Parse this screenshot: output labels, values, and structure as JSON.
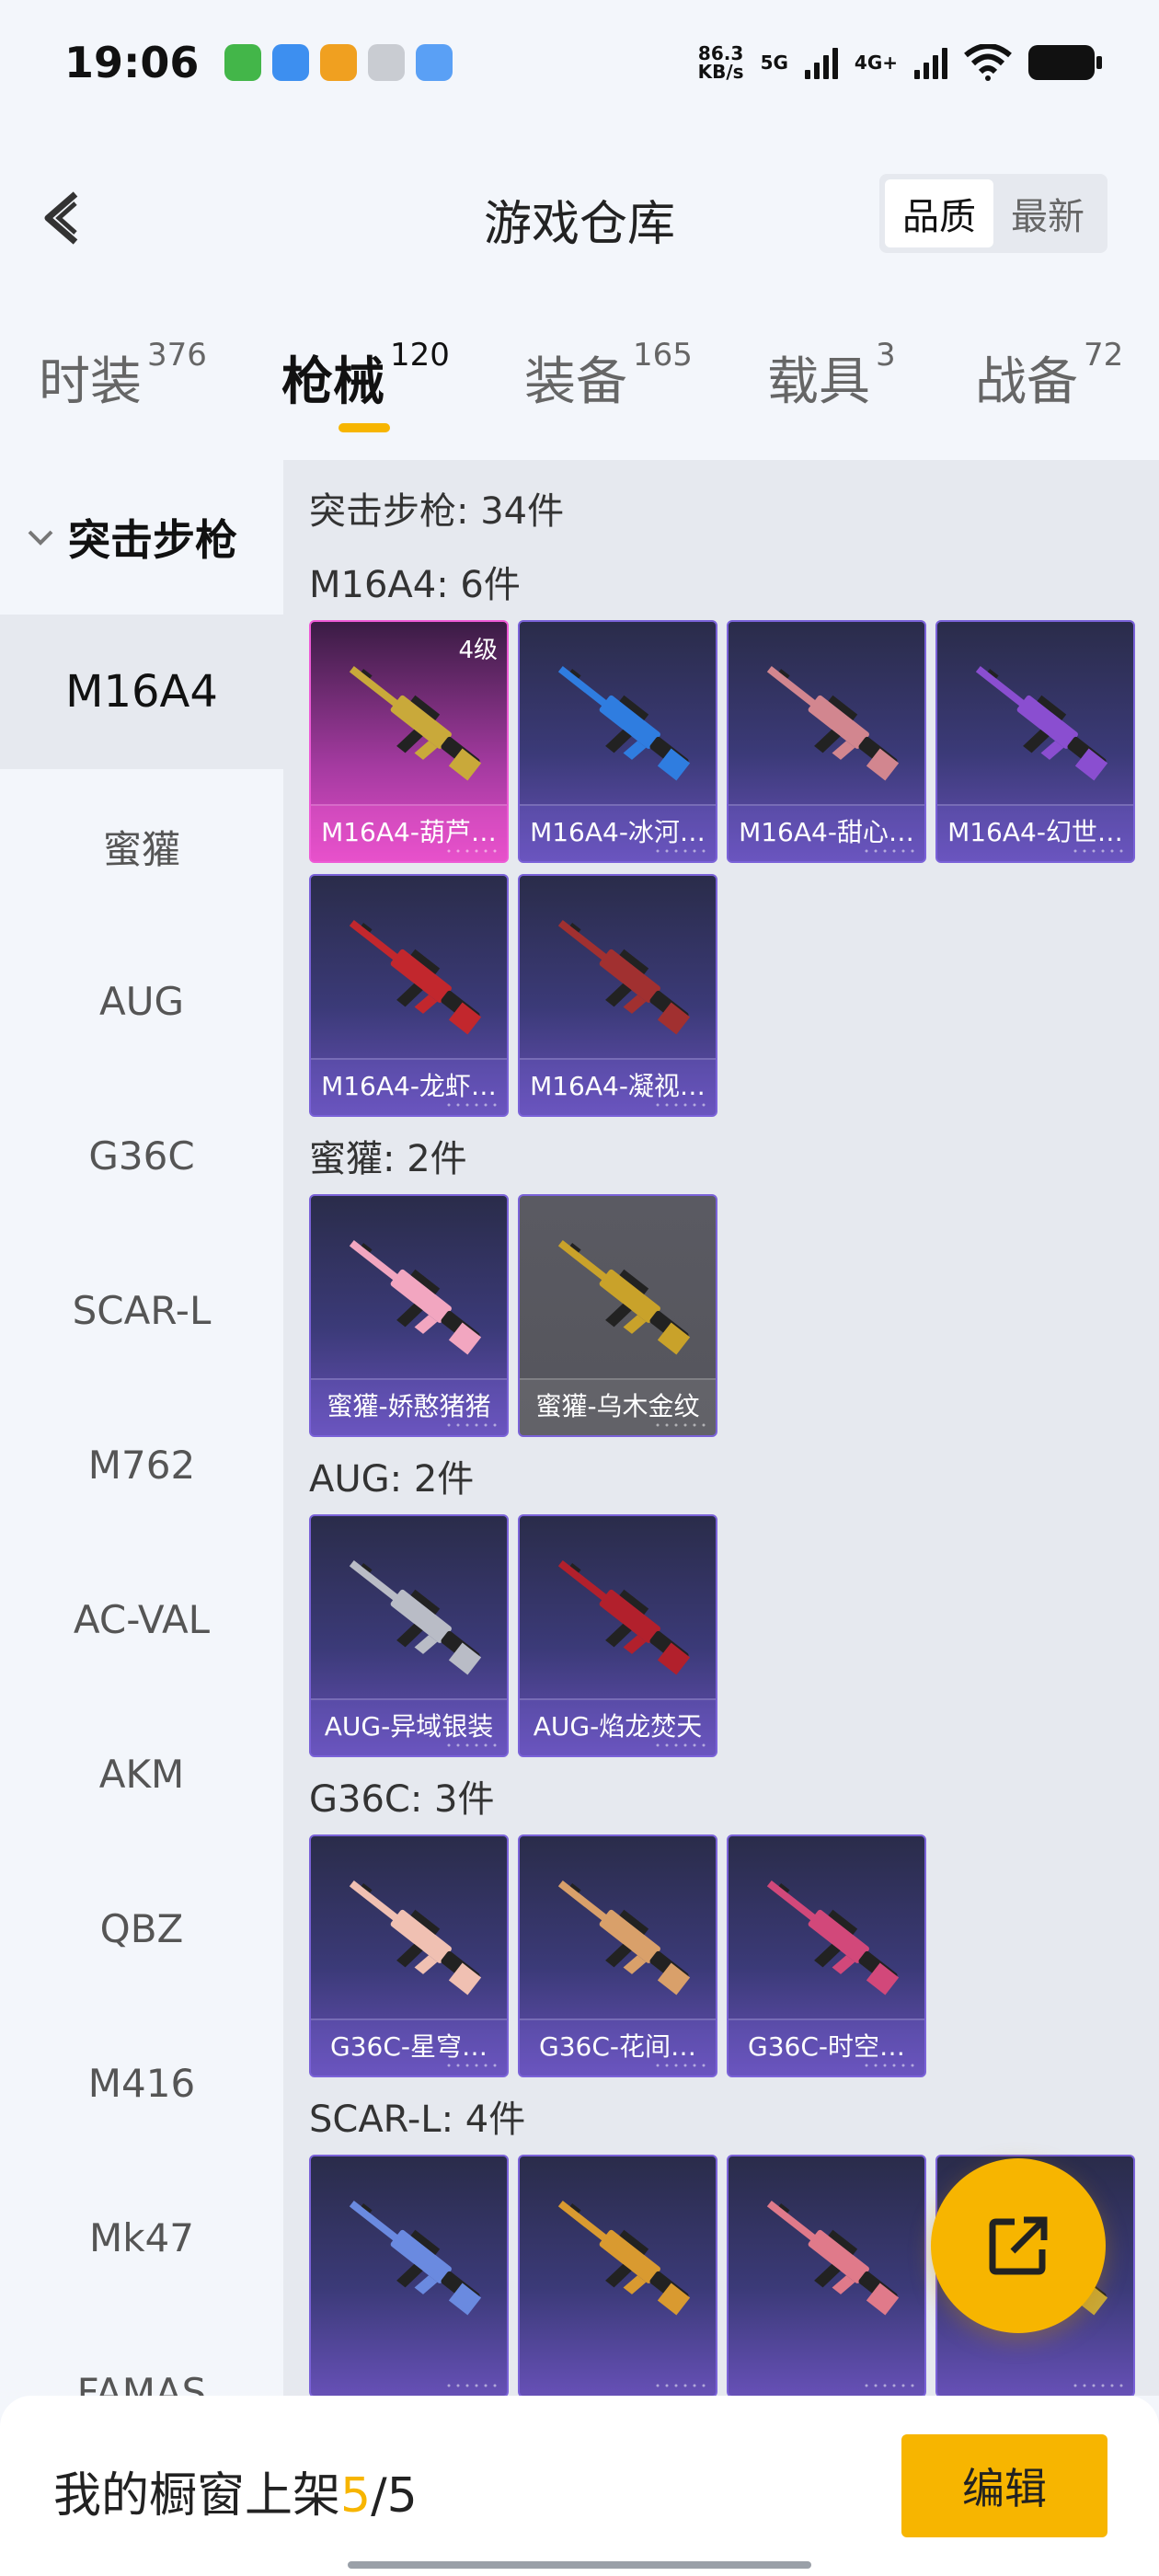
{
  "status_bar": {
    "time": "19:06",
    "speed_value": "86.3",
    "speed_unit": "KB/s",
    "network_1": "5G",
    "network_2": "4G+"
  },
  "header": {
    "title": "游戏仓库",
    "sort_options": [
      "品质",
      "最新"
    ],
    "active_sort": "品质"
  },
  "tabs": [
    {
      "label": "时装",
      "count": "376"
    },
    {
      "label": "枪械",
      "count": "120",
      "active": true
    },
    {
      "label": "装备",
      "count": "165"
    },
    {
      "label": "载具",
      "count": "3"
    },
    {
      "label": "战备",
      "count": "72"
    }
  ],
  "sidebar": {
    "group_label": "突击步枪",
    "items": [
      "M16A4",
      "蜜獾",
      "AUG",
      "G36C",
      "SCAR-L",
      "M762",
      "AC-VAL",
      "AKM",
      "QBZ",
      "M416",
      "Mk47",
      "FAMAS"
    ],
    "active_item": "M16A4"
  },
  "content": {
    "summary": "突击步枪: 34件",
    "sections": [
      {
        "title": "M16A4: 6件",
        "cards": [
          {
            "label": "M16A4-葫芦…",
            "level": "4级",
            "style": "pink",
            "gun": "#c9a93a"
          },
          {
            "label": "M16A4-冰河…",
            "style": "blue",
            "gun": "#2f7de0"
          },
          {
            "label": "M16A4-甜心…",
            "style": "blue",
            "gun": "#d2868f"
          },
          {
            "label": "M16A4-幻世…",
            "style": "blue",
            "gun": "#8a4ed0"
          },
          {
            "label": "M16A4-龙虾…",
            "style": "blue",
            "gun": "#c2272d"
          },
          {
            "label": "M16A4-凝视…",
            "style": "blue",
            "gun": "#a13030"
          }
        ]
      },
      {
        "title": "蜜獾: 2件",
        "cards": [
          {
            "label": "蜜獾-娇憨猪猪",
            "style": "blue",
            "gun": "#f2a6c0"
          },
          {
            "label": "蜜獾-乌木金纹",
            "style": "gray",
            "gun": "#c9a22a"
          }
        ]
      },
      {
        "title": "AUG: 2件",
        "cards": [
          {
            "label": "AUG-异域银装",
            "style": "blue",
            "gun": "#b9bcc6"
          },
          {
            "label": "AUG-焰龙焚天",
            "style": "blue",
            "gun": "#b2202c"
          }
        ]
      },
      {
        "title": "G36C: 3件",
        "cards": [
          {
            "label": "G36C-星穹…",
            "style": "blue",
            "gun": "#f0c0b2"
          },
          {
            "label": "G36C-花间…",
            "style": "blue",
            "gun": "#d9a06a"
          },
          {
            "label": "G36C-时空…",
            "style": "blue",
            "gun": "#d2487a"
          }
        ]
      },
      {
        "title": "SCAR-L: 4件",
        "cards": [
          {
            "label": "",
            "style": "blue",
            "gun": "#6a8ae0"
          },
          {
            "label": "",
            "style": "blue",
            "gun": "#d99a30"
          },
          {
            "label": "",
            "style": "blue",
            "gun": "#e07a8a"
          },
          {
            "label": "",
            "style": "blue",
            "gun": "#c9a93a"
          }
        ]
      }
    ]
  },
  "bottom_bar": {
    "shelf_prefix": "我的橱窗上架",
    "shelf_current": "5",
    "shelf_sep": "/",
    "shelf_total": "5",
    "edit_label": "编辑"
  },
  "colors": {
    "accent": "#f7b500",
    "background": "#f3f6fb",
    "content_background": "#e6e9ef"
  }
}
